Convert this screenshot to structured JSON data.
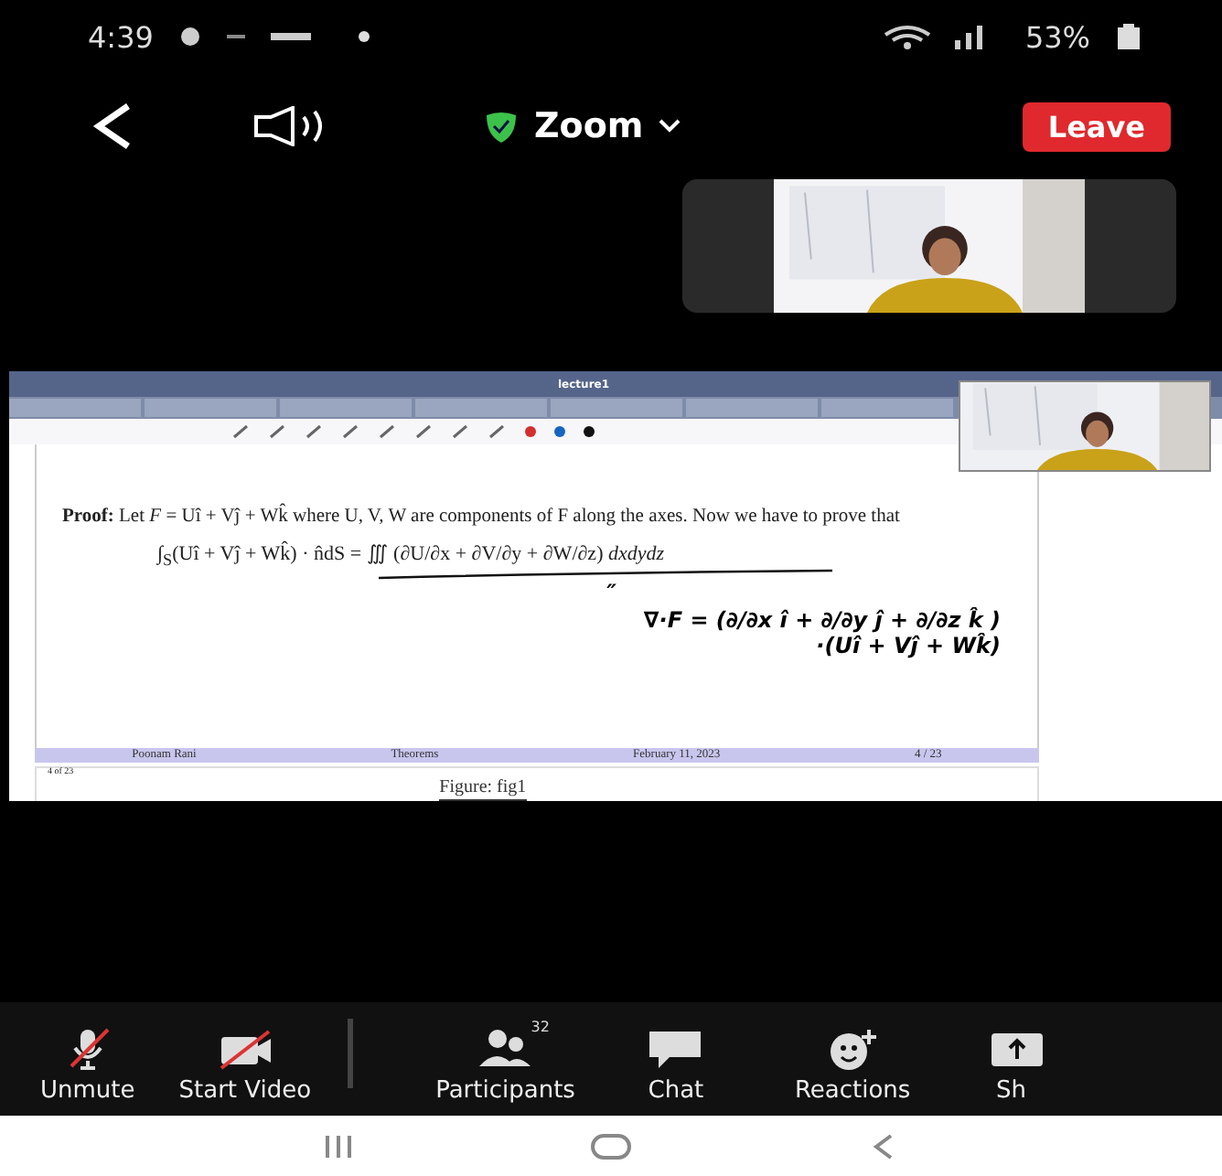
{
  "status_bar": {
    "time": "4:39",
    "battery": "53%"
  },
  "top_bar": {
    "title": "Zoom",
    "leave_button": "Leave"
  },
  "shared_screen": {
    "app_title": "lecture1",
    "slide": {
      "proof": "**Proof:** Let *F* = Uî + Vĵ + Wk̂ where U, V, W are components of F along the axes. Now we have to prove that",
      "formula": "∫$_{S}$(Uî + Vĵ + Wk̂) · n̂dS = ∭ (∂U/∂x + ∂V/∂y + ∂W/∂z) *dxdydz*",
      "handwriting": [
        "″",
        "∇·F = (∂/∂x î + ∂/∂y ĵ + ∂/∂z k̂ )",
        "·(Uî + Vĵ + Wk̂)"
      ],
      "footer": [
        "Poonam Rani",
        "Theorems",
        "February 11, 2023",
        "4 / 23"
      ],
      "page_label": "4 of 23",
      "next_caption": "Figure: fig1"
    }
  },
  "toolbar": [
    {
      "kind": "mic-off",
      "label": "Unmute"
    },
    {
      "kind": "video-off",
      "label": "Start Video"
    },
    {
      "kind": "participants",
      "label": "Participants",
      "badge": "32"
    },
    {
      "kind": "chat",
      "label": "Chat"
    },
    {
      "kind": "reactions",
      "label": "Reactions"
    },
    {
      "kind": "share",
      "label": "Sh"
    }
  ]
}
